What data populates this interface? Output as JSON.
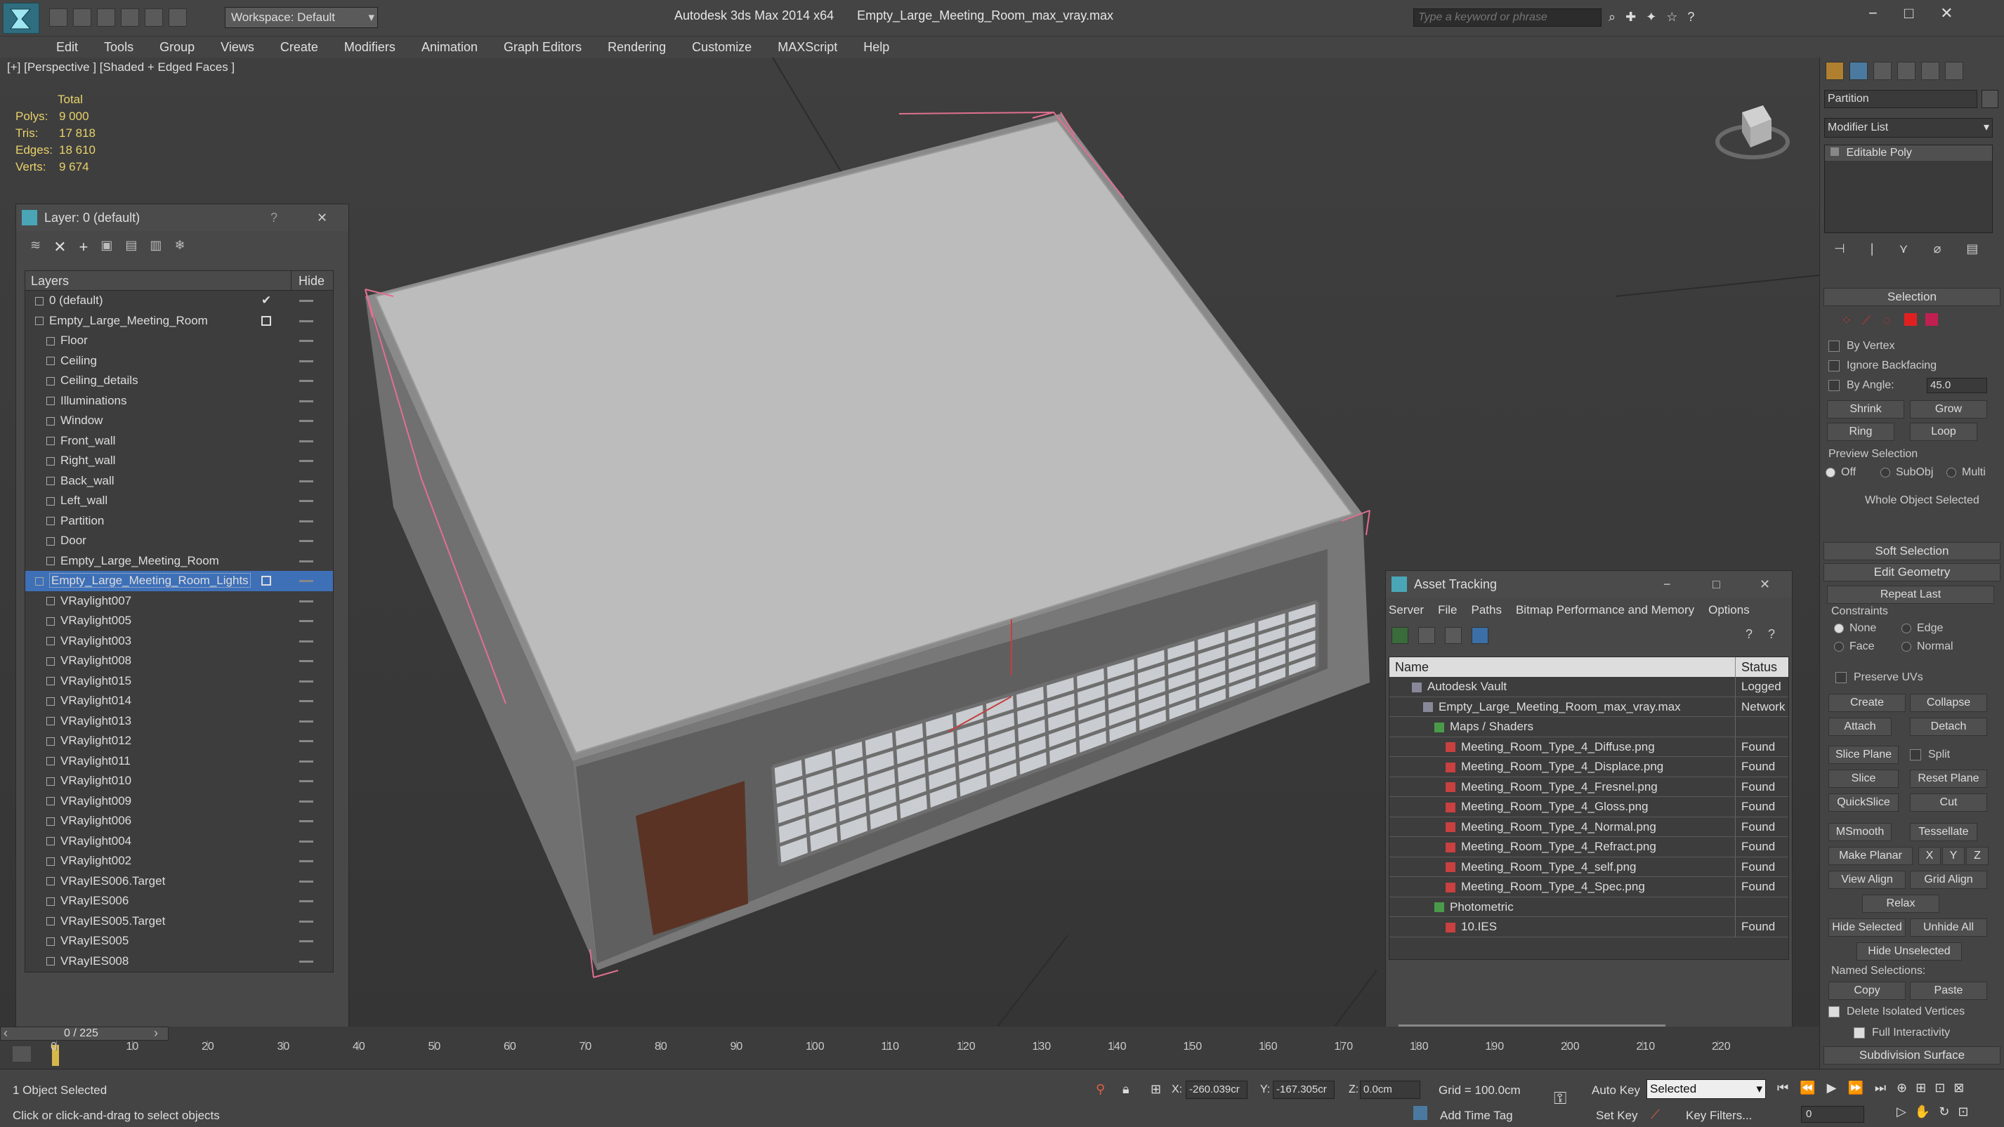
{
  "app": {
    "title": "Autodesk 3ds Max  2014 x64",
    "file": "Empty_Large_Meeting_Room_max_vray.max",
    "workspace": "Workspace: Default",
    "search_placeholder": "Type a keyword or phrase"
  },
  "menu": [
    "Edit",
    "Tools",
    "Group",
    "Views",
    "Create",
    "Modifiers",
    "Animation",
    "Graph Editors",
    "Rendering",
    "Customize",
    "MAXScript",
    "Help"
  ],
  "viewport": {
    "label": "[+] [Perspective ] [Shaded + Edged Faces ]",
    "stats": {
      "header": "Total",
      "rows": [
        {
          "label": "Polys:",
          "value": "9 000"
        },
        {
          "label": "Tris:",
          "value": "17 818"
        },
        {
          "label": "Edges:",
          "value": "18 610"
        },
        {
          "label": "Verts:",
          "value": "9 674"
        }
      ]
    }
  },
  "layer_panel": {
    "title": "Layer: 0 (default)",
    "help": "?",
    "col_layers": "Layers",
    "col_hide": "Hide",
    "rows": [
      {
        "name": "0 (default)",
        "level": 0,
        "check": true
      },
      {
        "name": "Empty_Large_Meeting_Room",
        "level": 0,
        "box": true
      },
      {
        "name": "Floor",
        "level": 1
      },
      {
        "name": "Ceiling",
        "level": 1
      },
      {
        "name": "Ceiling_details",
        "level": 1
      },
      {
        "name": "Illuminations",
        "level": 1
      },
      {
        "name": "Window",
        "level": 1
      },
      {
        "name": "Front_wall",
        "level": 1
      },
      {
        "name": "Right_wall",
        "level": 1
      },
      {
        "name": "Back_wall",
        "level": 1
      },
      {
        "name": "Left_wall",
        "level": 1
      },
      {
        "name": "Partition",
        "level": 1
      },
      {
        "name": "Door",
        "level": 1
      },
      {
        "name": "Empty_Large_Meeting_Room",
        "level": 1
      },
      {
        "name": "Empty_Large_Meeting_Room_Lights",
        "level": 0,
        "box": true,
        "selected": true
      },
      {
        "name": "VRaylight007",
        "level": 1
      },
      {
        "name": "VRaylight005",
        "level": 1
      },
      {
        "name": "VRaylight003",
        "level": 1
      },
      {
        "name": "VRaylight008",
        "level": 1
      },
      {
        "name": "VRaylight015",
        "level": 1
      },
      {
        "name": "VRaylight014",
        "level": 1
      },
      {
        "name": "VRaylight013",
        "level": 1
      },
      {
        "name": "VRaylight012",
        "level": 1
      },
      {
        "name": "VRaylight011",
        "level": 1
      },
      {
        "name": "VRaylight010",
        "level": 1
      },
      {
        "name": "VRaylight009",
        "level": 1
      },
      {
        "name": "VRaylight006",
        "level": 1
      },
      {
        "name": "VRaylight004",
        "level": 1
      },
      {
        "name": "VRaylight002",
        "level": 1
      },
      {
        "name": "VRayIES006.Target",
        "level": 1
      },
      {
        "name": "VRayIES006",
        "level": 1
      },
      {
        "name": "VRayIES005.Target",
        "level": 1
      },
      {
        "name": "VRayIES005",
        "level": 1
      },
      {
        "name": "VRayIES008",
        "level": 1
      }
    ]
  },
  "asset_panel": {
    "title": "Asset Tracking",
    "menu": [
      "Server",
      "File",
      "Paths",
      "Bitmap Performance and Memory",
      "Options"
    ],
    "col_name": "Name",
    "col_status": "Status",
    "rows": [
      {
        "name": "Autodesk Vault",
        "level": 1,
        "status": "Logged"
      },
      {
        "name": "Empty_Large_Meeting_Room_max_vray.max",
        "level": 2,
        "status": "Network"
      },
      {
        "name": "Maps / Shaders",
        "level": 3,
        "status": ""
      },
      {
        "name": "Meeting_Room_Type_4_Diffuse.png",
        "level": 4,
        "status": "Found"
      },
      {
        "name": "Meeting_Room_Type_4_Displace.png",
        "level": 4,
        "status": "Found"
      },
      {
        "name": "Meeting_Room_Type_4_Fresnel.png",
        "level": 4,
        "status": "Found"
      },
      {
        "name": "Meeting_Room_Type_4_Gloss.png",
        "level": 4,
        "status": "Found"
      },
      {
        "name": "Meeting_Room_Type_4_Normal.png",
        "level": 4,
        "status": "Found"
      },
      {
        "name": "Meeting_Room_Type_4_Refract.png",
        "level": 4,
        "status": "Found"
      },
      {
        "name": "Meeting_Room_Type_4_self.png",
        "level": 4,
        "status": "Found"
      },
      {
        "name": "Meeting_Room_Type_4_Spec.png",
        "level": 4,
        "status": "Found"
      },
      {
        "name": "Photometric",
        "level": 3,
        "status": ""
      },
      {
        "name": "10.IES",
        "level": 4,
        "status": "Found"
      }
    ]
  },
  "command_panel": {
    "object_name": "Partition",
    "modifier_list": "Modifier List",
    "stack_item": "Editable Poly",
    "selection_title": "Selection",
    "by_vertex": "By Vertex",
    "ignore_backfacing": "Ignore Backfacing",
    "by_angle": "By Angle:",
    "by_angle_value": "45.0",
    "shrink": "Shrink",
    "grow": "Grow",
    "ring": "Ring",
    "loop": "Loop",
    "preview_selection": "Preview Selection",
    "off": "Off",
    "subobj": "SubObj",
    "multi": "Multi",
    "whole_object": "Whole Object Selected",
    "soft_selection": "Soft Selection",
    "edit_geometry": "Edit Geometry",
    "repeat_last": "Repeat Last",
    "constraints": "Constraints",
    "none": "None",
    "edge": "Edge",
    "face": "Face",
    "normal": "Normal",
    "preserve_uvs": "Preserve UVs",
    "create": "Create",
    "collapse": "Collapse",
    "attach": "Attach",
    "detach": "Detach",
    "slice_plane": "Slice Plane",
    "split": "Split",
    "slice": "Slice",
    "reset_plane": "Reset Plane",
    "quickslice": "QuickSlice",
    "cut": "Cut",
    "msmooth": "MSmooth",
    "tessellate": "Tessellate",
    "make_planar": "Make Planar",
    "x": "X",
    "y": "Y",
    "z": "Z",
    "view_align": "View Align",
    "grid_align": "Grid Align",
    "relax": "Relax",
    "hide_selected": "Hide Selected",
    "unhide_all": "Unhide All",
    "hide_unselected": "Hide Unselected",
    "named_selections": "Named Selections:",
    "copy": "Copy",
    "paste": "Paste",
    "delete_isolated": "Delete Isolated Vertices",
    "full_interactivity": "Full Interactivity",
    "subdivision_surface": "Subdivision Surface"
  },
  "timeline": {
    "frame": "0 / 225",
    "ticks": [
      "0",
      "10",
      "20",
      "30",
      "40",
      "50",
      "60",
      "70",
      "80",
      "90",
      "100",
      "110",
      "120",
      "130",
      "140",
      "150",
      "160",
      "170",
      "180",
      "190",
      "200",
      "210",
      "220"
    ]
  },
  "status": {
    "objects": "1 Object Selected",
    "prompt": "Click or click-and-drag to select objects",
    "x_label": "X:",
    "x_value": "-260.039cr",
    "y_label": "Y:",
    "y_value": "-167.305cr",
    "z_label": "Z:",
    "z_value": "0.0cm",
    "grid": "Grid = 100.0cm",
    "add_time_tag": "Add Time Tag",
    "auto_key": "Auto Key",
    "set_key": "Set Key",
    "selected": "Selected",
    "key_filters": "Key Filters...",
    "frame_value": "0"
  }
}
